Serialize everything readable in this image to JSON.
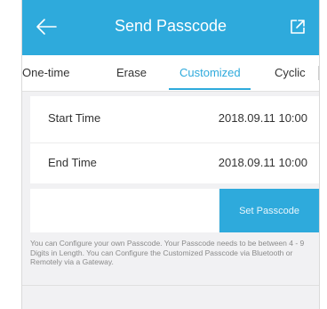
{
  "header": {
    "title": "Send Passcode",
    "bg_color": "#2eaadc",
    "back_icon": "arrow-left-icon",
    "share_icon": "share-icon"
  },
  "tabs": [
    {
      "label": "One-time",
      "active": false
    },
    {
      "label": "Erase",
      "active": false
    },
    {
      "label": "Customized",
      "active": true
    },
    {
      "label": "Cyclic",
      "active": false
    }
  ],
  "time_settings": {
    "start_label": "Start Time",
    "start_value": "2018.09.11 10:00",
    "end_label": "End Time",
    "end_value": "2018.09.11 10:00"
  },
  "passcode": {
    "value": "",
    "button_label": "Set Passcode"
  },
  "info_text": "You can Configure your own Passcode. Your Passcode needs to be between 4 - 9 Digits in Length. You can Configure the Customized Passcode via Bluetooth or Remotely via a Gateway."
}
